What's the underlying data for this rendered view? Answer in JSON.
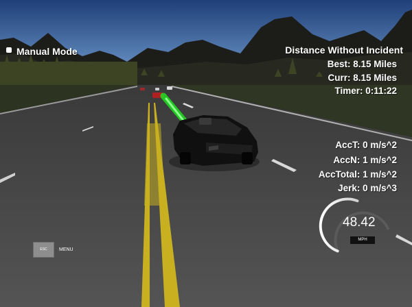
{
  "hud": {
    "mode_label": "Manual Mode",
    "distance_title": "Distance Without Incident",
    "best": "Best: 8.15 Miles",
    "curr": "Curr: 8.15 Miles",
    "timer": "Timer: 0:11:22",
    "acc_t": "AccT: 0 m/s^2",
    "acc_n": "AccN: 1 m/s^2",
    "acc_total": "AccTotal: 1 m/s^2",
    "jerk": "Jerk: 0 m/s^3"
  },
  "speedometer": {
    "value": "48.42",
    "unit": "MPH",
    "fill_fraction": 0.6
  },
  "controls": {
    "esc_label": "ESC",
    "menu_label": "MENU"
  },
  "colors": {
    "sky_top": "#1f3f78",
    "sky_bottom": "#6f9ed6",
    "road": "#4a4a4a",
    "grass": "#2f3a22",
    "center_line": "#c8b020",
    "trajectory": "#22dd22"
  }
}
